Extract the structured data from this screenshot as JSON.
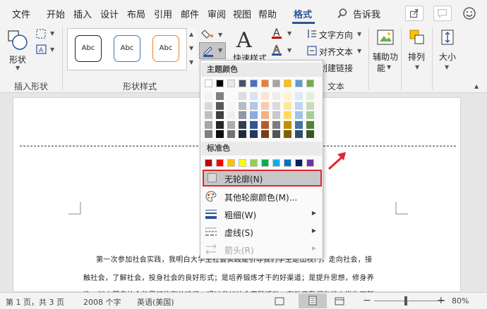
{
  "tabs": [
    "文件",
    "开始",
    "插入",
    "设计",
    "布局",
    "引用",
    "邮件",
    "审阅",
    "视图",
    "帮助",
    "格式"
  ],
  "search_label": "告诉我",
  "ribbon": {
    "insert_shapes": {
      "shape_button": "形状",
      "group_label": "插入形状"
    },
    "shape_styles": {
      "swatches": [
        "Abc",
        "Abc",
        "Abc"
      ],
      "group_label": "形状样式"
    },
    "wordart": {
      "quick_styles": "快速样式"
    },
    "text": {
      "text_direction": "文字方向",
      "align_text": "对齐文本",
      "create_link": "创建链接",
      "group_label": "文本"
    },
    "accessibility": {
      "alt_text": "辅助功",
      "alt_text_2": "能"
    },
    "arrange": {
      "label": "排列"
    },
    "size": {
      "label": "大小"
    }
  },
  "outline_menu": {
    "theme_colors_header": "主题颜色",
    "theme_colors": [
      "#ffffff",
      "#000000",
      "#e7e6e6",
      "#44546a",
      "#4472c4",
      "#ed7d31",
      "#a5a5a5",
      "#ffc000",
      "#5b9bd5",
      "#70ad47"
    ],
    "standard_colors_header": "标准色",
    "standard_colors": [
      "#c00000",
      "#ff0000",
      "#ffc000",
      "#ffff00",
      "#92d050",
      "#00b050",
      "#00b0f0",
      "#0070c0",
      "#002060",
      "#7030a0"
    ],
    "items": {
      "no_outline": "无轮廓(N)",
      "more_colors": "其他轮廓颜色(M)...",
      "weight": "粗细(W)",
      "dashes": "虚线(S)",
      "arrows": "箭头(R)"
    }
  },
  "document": {
    "lines": [
      "第一次参加社会实践，我明白大学生社会实践是引导我们学生走出校门，走向社会，接",
      "触社会，了解社会，投身社会的良好形式；是培养锻炼才干的好渠道；是提升思想，修身养",
      "性，树立服务社会的思想的有效途径。通过参加社会实践活动，有助于我们在校大学生更新"
    ]
  },
  "status": {
    "page": "第 1 页，共 3 页",
    "words": "2008 个字",
    "language": "英语(美国)",
    "zoom": "80%"
  },
  "accent_color": "#2b579a",
  "highlight_color": "#e0262f"
}
